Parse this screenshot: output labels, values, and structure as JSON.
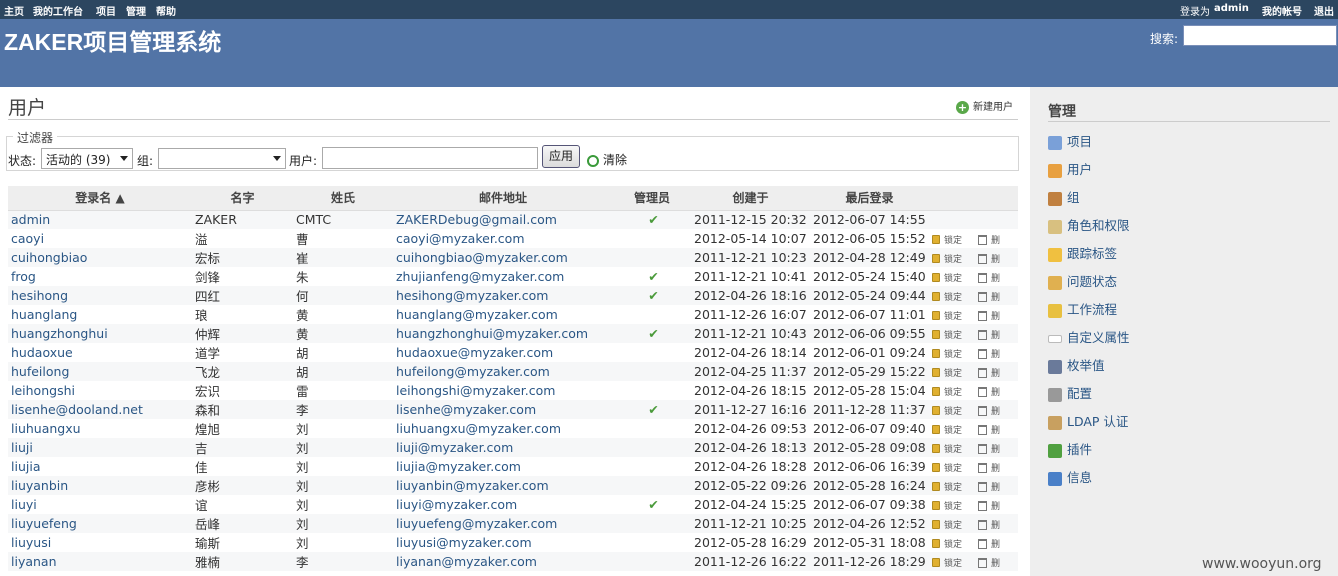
{
  "top_menu": {
    "home": "主页",
    "my_page": "我的工作台",
    "projects": "项目",
    "admin": "管理",
    "help": "帮助",
    "logged_as_label": "登录为",
    "logged_user": "admin",
    "my_account": "我的帐号",
    "logout": "退出"
  },
  "header": {
    "title": "ZAKER项目管理系统",
    "search_label": "搜索:"
  },
  "page": {
    "title": "用户",
    "new_user": "新建用户"
  },
  "filters": {
    "legend": "过滤器",
    "status_label": "状态:",
    "status_value": "活动的 (39)",
    "group_label": "组:",
    "group_value": "",
    "user_label": "用户:",
    "user_value": "",
    "apply": "应用",
    "clear": "清除"
  },
  "table": {
    "headers": [
      "登录名 ▲",
      "名字",
      "姓氏",
      "邮件地址",
      "管理员",
      "创建于",
      "最后登录"
    ],
    "lock_label": "锁定",
    "delete_label": "删",
    "admin_mark": "✔",
    "rows": [
      {
        "login": "admin",
        "first": "ZAKER",
        "last": "CMTC",
        "mail": "ZAKERDebug@gmail.com",
        "admin": true,
        "created": "2011-12-15 20:32",
        "last_login": "2012-06-07 14:55",
        "actions": false
      },
      {
        "login": "caoyi",
        "first": "溢",
        "last": "曹",
        "mail": "caoyi@myzaker.com",
        "admin": false,
        "created": "2012-05-14 10:07",
        "last_login": "2012-06-05 15:52",
        "actions": true
      },
      {
        "login": "cuihongbiao",
        "first": "宏标",
        "last": "崔",
        "mail": "cuihongbiao@myzaker.com",
        "admin": false,
        "created": "2011-12-21 10:23",
        "last_login": "2012-04-28 12:49",
        "actions": true
      },
      {
        "login": "frog",
        "first": "剑锋",
        "last": "朱",
        "mail": "zhujianfeng@myzaker.com",
        "admin": true,
        "created": "2011-12-21 10:41",
        "last_login": "2012-05-24 15:40",
        "actions": true
      },
      {
        "login": "hesihong",
        "first": "四红",
        "last": "何",
        "mail": "hesihong@myzaker.com",
        "admin": true,
        "created": "2012-04-26 18:16",
        "last_login": "2012-05-24 09:44",
        "actions": true
      },
      {
        "login": "huanglang",
        "first": "琅",
        "last": "黄",
        "mail": "huanglang@myzaker.com",
        "admin": false,
        "created": "2011-12-26 16:07",
        "last_login": "2012-06-07 11:01",
        "actions": true
      },
      {
        "login": "huangzhonghui",
        "first": "仲辉",
        "last": "黄",
        "mail": "huangzhonghui@myzaker.com",
        "admin": true,
        "created": "2011-12-21 10:43",
        "last_login": "2012-06-06 09:55",
        "actions": true
      },
      {
        "login": "hudaoxue",
        "first": "道学",
        "last": "胡",
        "mail": "hudaoxue@myzaker.com",
        "admin": false,
        "created": "2012-04-26 18:14",
        "last_login": "2012-06-01 09:24",
        "actions": true
      },
      {
        "login": "hufeilong",
        "first": "飞龙",
        "last": "胡",
        "mail": "hufeilong@myzaker.com",
        "admin": false,
        "created": "2012-04-25 11:37",
        "last_login": "2012-05-29 15:22",
        "actions": true
      },
      {
        "login": "leihongshi",
        "first": "宏识",
        "last": "雷",
        "mail": "leihongshi@myzaker.com",
        "admin": false,
        "created": "2012-04-26 18:15",
        "last_login": "2012-05-28 15:04",
        "actions": true
      },
      {
        "login": "lisenhe@dooland.net",
        "first": "森和",
        "last": "李",
        "mail": "lisenhe@myzaker.com",
        "admin": true,
        "created": "2011-12-27 16:16",
        "last_login": "2011-12-28 11:37",
        "actions": true
      },
      {
        "login": "liuhuangxu",
        "first": "煌旭",
        "last": "刘",
        "mail": "liuhuangxu@myzaker.com",
        "admin": false,
        "created": "2012-04-26 09:53",
        "last_login": "2012-06-07 09:40",
        "actions": true
      },
      {
        "login": "liuji",
        "first": "吉",
        "last": "刘",
        "mail": "liuji@myzaker.com",
        "admin": false,
        "created": "2012-04-26 18:13",
        "last_login": "2012-05-28 09:08",
        "actions": true
      },
      {
        "login": "liujia",
        "first": "佳",
        "last": "刘",
        "mail": "liujia@myzaker.com",
        "admin": false,
        "created": "2012-04-26 18:28",
        "last_login": "2012-06-06 16:39",
        "actions": true
      },
      {
        "login": "liuyanbin",
        "first": "彦彬",
        "last": "刘",
        "mail": "liuyanbin@myzaker.com",
        "admin": false,
        "created": "2012-05-22 09:26",
        "last_login": "2012-05-28 16:24",
        "actions": true
      },
      {
        "login": "liuyi",
        "first": "谊",
        "last": "刘",
        "mail": "liuyi@myzaker.com",
        "admin": true,
        "created": "2012-04-24 15:25",
        "last_login": "2012-06-07 09:38",
        "actions": true
      },
      {
        "login": "liuyuefeng",
        "first": "岳峰",
        "last": "刘",
        "mail": "liuyuefeng@myzaker.com",
        "admin": false,
        "created": "2011-12-21 10:25",
        "last_login": "2012-04-26 12:52",
        "actions": true
      },
      {
        "login": "liuyusi",
        "first": "瑜斯",
        "last": "刘",
        "mail": "liuyusi@myzaker.com",
        "admin": false,
        "created": "2012-05-28 16:29",
        "last_login": "2012-05-31 18:08",
        "actions": true
      },
      {
        "login": "liyanan",
        "first": "雅楠",
        "last": "李",
        "mail": "liyanan@myzaker.com",
        "admin": false,
        "created": "2011-12-26 16:22",
        "last_login": "2011-12-26 18:29",
        "actions": true
      }
    ]
  },
  "sidebar": {
    "title": "管理",
    "items": [
      {
        "label": "项目",
        "icon": "projects-icon",
        "color": "#7aa0d8"
      },
      {
        "label": "用户",
        "icon": "user-icon",
        "color": "#e8a040"
      },
      {
        "label": "组",
        "icon": "group-icon",
        "color": "#c08040"
      },
      {
        "label": "角色和权限",
        "icon": "roles-icon",
        "color": "#d8c080"
      },
      {
        "label": "跟踪标签",
        "icon": "tracker-icon",
        "color": "#f0c040"
      },
      {
        "label": "问题状态",
        "icon": "issue-status-icon",
        "color": "#e0b050"
      },
      {
        "label": "工作流程",
        "icon": "workflow-icon",
        "color": "#e8c040"
      },
      {
        "label": "自定义属性",
        "icon": "custom-field-icon",
        "color": "#ffffff"
      },
      {
        "label": "枚举值",
        "icon": "list-icon",
        "color": "#6a7a9a"
      },
      {
        "label": "配置",
        "icon": "settings-icon",
        "color": "#999999"
      },
      {
        "label": "LDAP 认证",
        "icon": "ldap-icon",
        "color": "#c8a060"
      },
      {
        "label": "插件",
        "icon": "plugin-icon",
        "color": "#50a040"
      },
      {
        "label": "信息",
        "icon": "info-icon",
        "color": "#4a80c8"
      }
    ]
  },
  "watermark": "www.wooyun.org"
}
